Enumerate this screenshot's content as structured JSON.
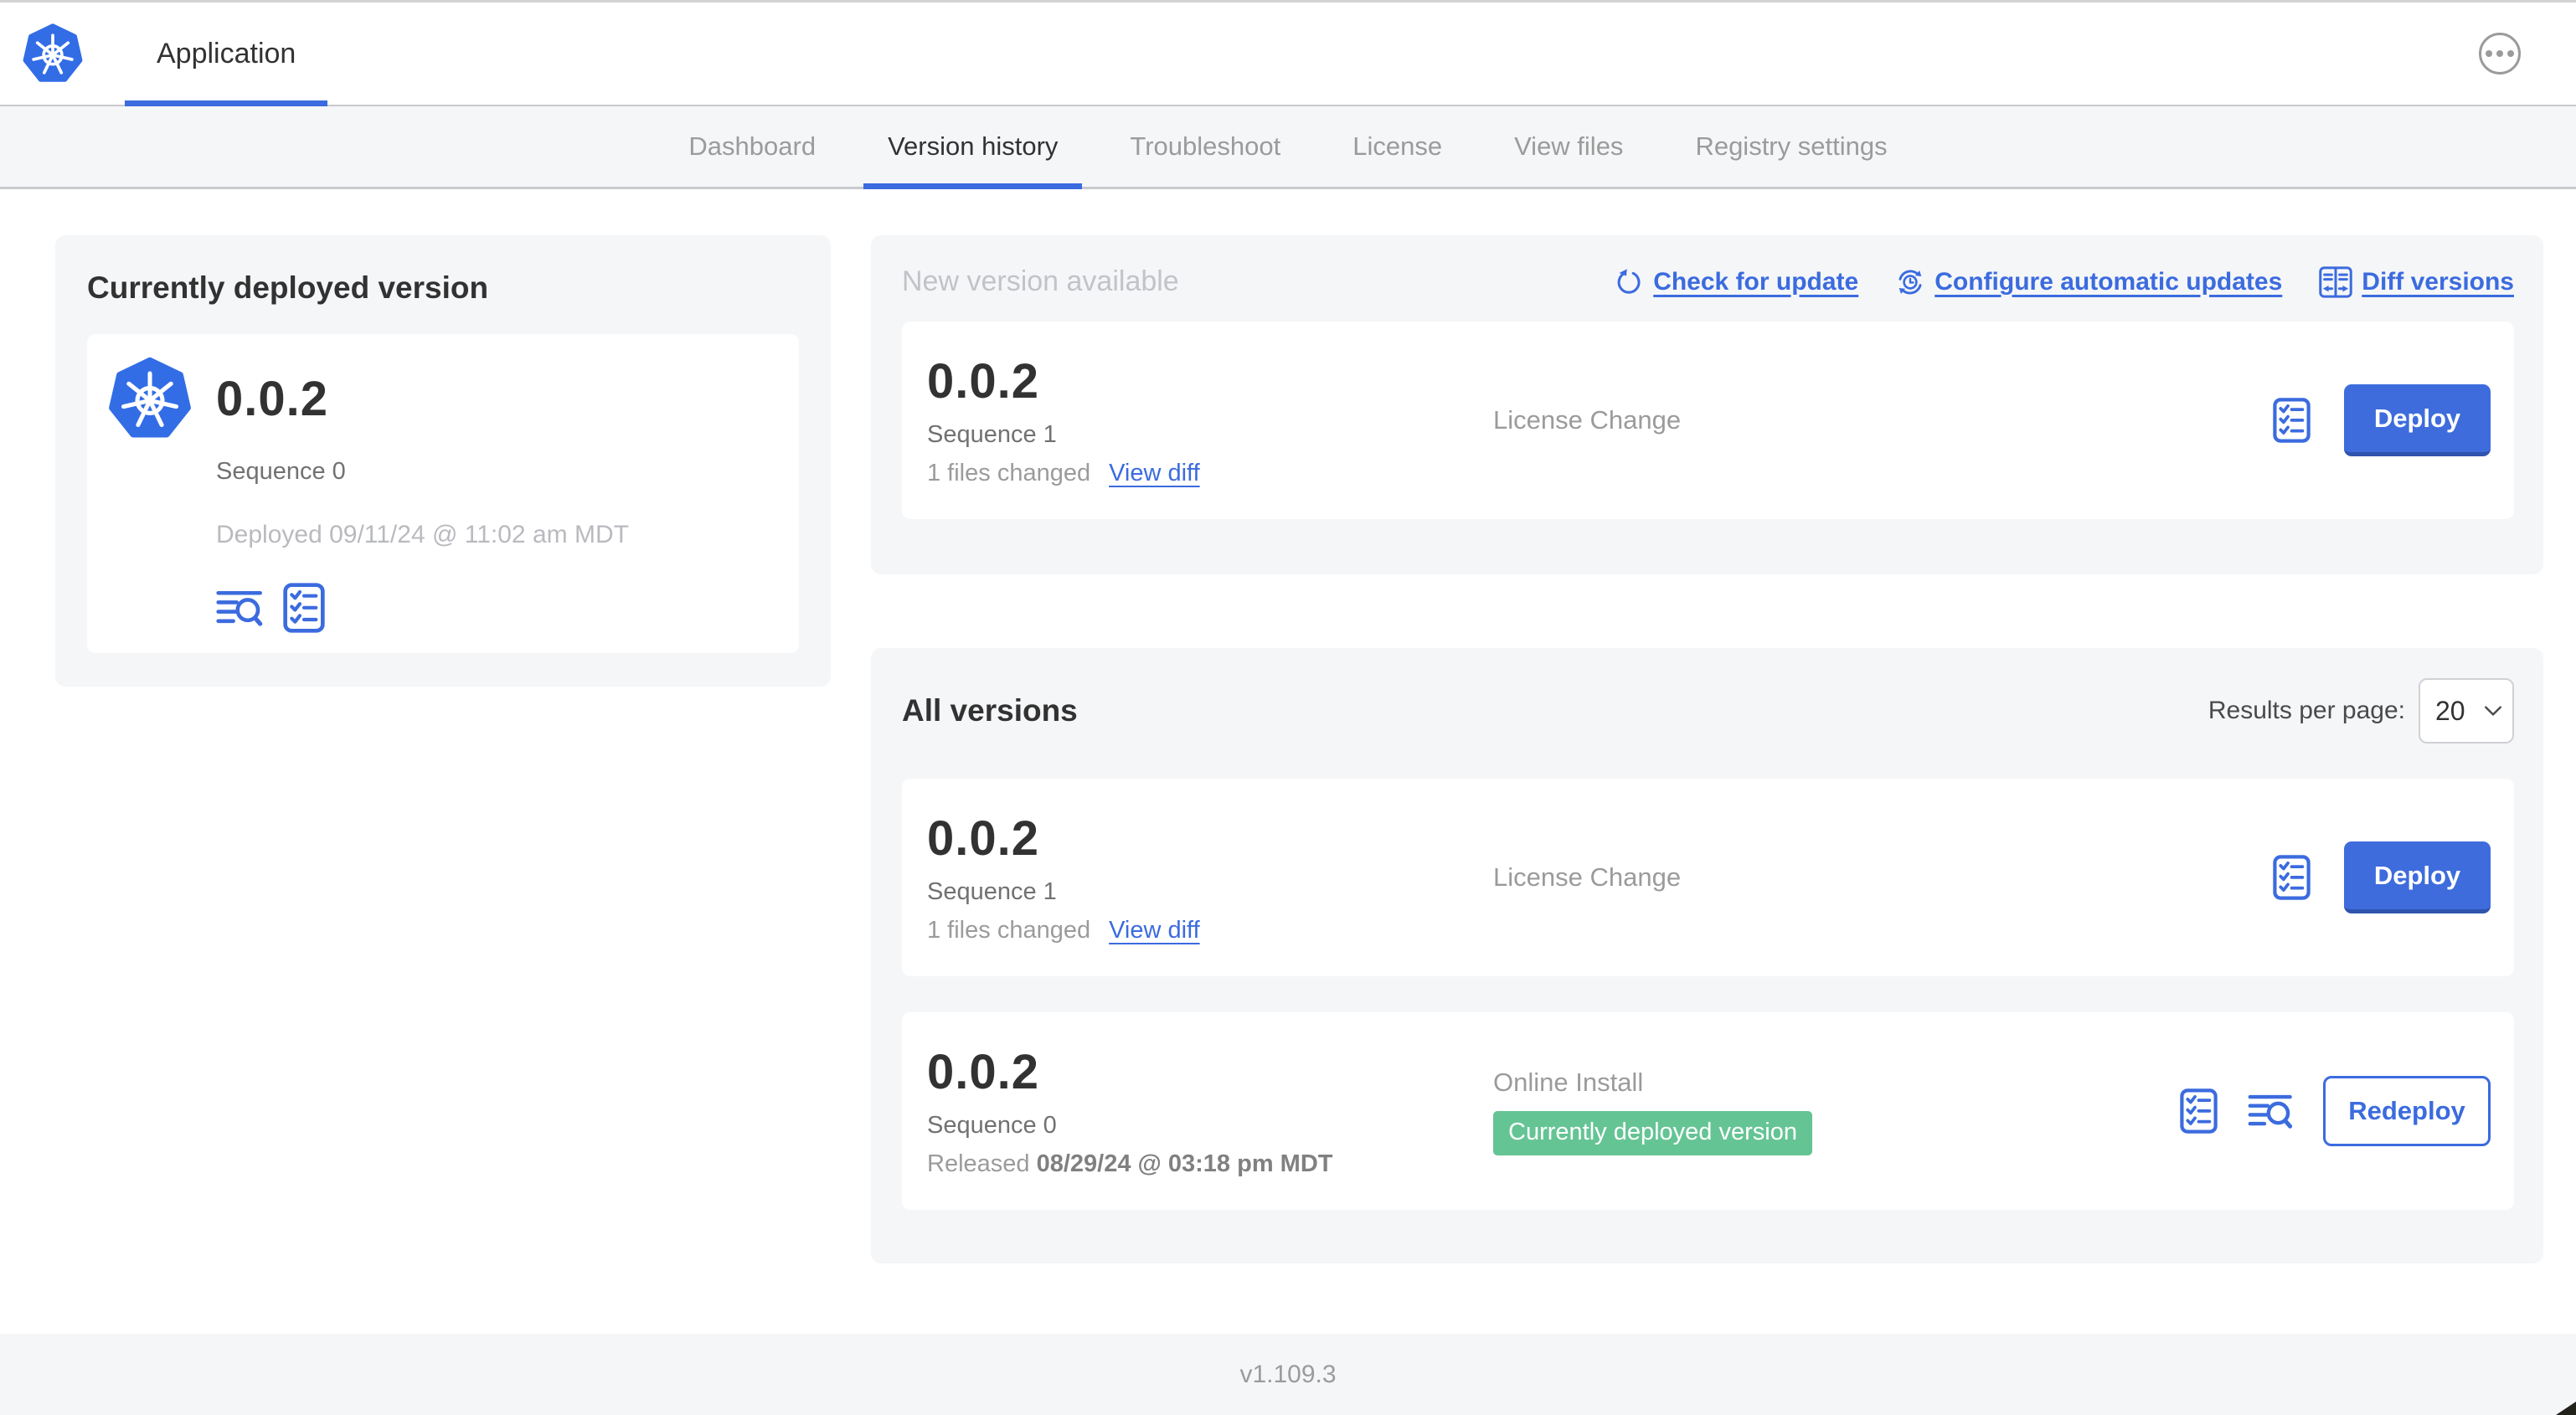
{
  "colors": {
    "accent_blue": "#3b6bde",
    "badge_green": "#65c494",
    "logo_blue": "#326de6"
  },
  "header": {
    "app_tab_label": "Application"
  },
  "nav": {
    "active_tab": "Version history",
    "tabs": [
      {
        "label": "Dashboard"
      },
      {
        "label": "Version history"
      },
      {
        "label": "Troubleshoot"
      },
      {
        "label": "License"
      },
      {
        "label": "View files"
      },
      {
        "label": "Registry settings"
      }
    ]
  },
  "current_version": {
    "title": "Currently deployed version",
    "version": "0.0.2",
    "sequence": "Sequence 0",
    "deployed": "Deployed 09/11/24 @ 11:02 am MDT"
  },
  "new_version": {
    "title": "New version available",
    "check_for_update_label": "Check for update",
    "configure_updates_label": "Configure automatic updates",
    "diff_versions_label": "Diff versions",
    "card": {
      "version": "0.0.2",
      "sequence": "Sequence 1",
      "files_changed": "1 files changed",
      "view_diff_label": "View diff",
      "source": "License Change",
      "deploy_label": "Deploy"
    }
  },
  "all_versions": {
    "title": "All versions",
    "results_per_page_label": "Results per page:",
    "results_per_page_value": "20",
    "rows": [
      {
        "version": "0.0.2",
        "sequence": "Sequence 1",
        "files_changed": "1 files changed",
        "view_diff_label": "View diff",
        "source": "License Change",
        "action_label": "Deploy"
      },
      {
        "version": "0.0.2",
        "sequence": "Sequence 0",
        "released_label": "Released",
        "released_date": "08/29/24 @ 03:18 pm MDT",
        "source": "Online Install",
        "status_badge": "Currently deployed version",
        "action_label": "Redeploy"
      }
    ]
  },
  "footer": {
    "app_version": "v1.109.3"
  }
}
